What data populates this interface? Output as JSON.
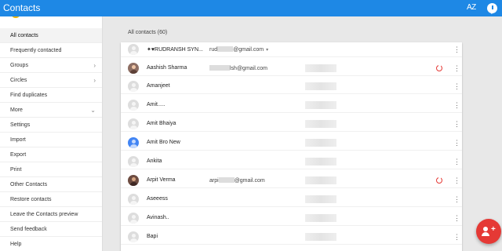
{
  "app": {
    "title": "Contacts",
    "sort_label": "AZ"
  },
  "sidebar": {
    "items": [
      {
        "label": "All contacts"
      },
      {
        "label": "Frequently contacted"
      },
      {
        "label": "Groups"
      },
      {
        "label": "Circles"
      },
      {
        "label": "Find duplicates"
      },
      {
        "label": "More"
      },
      {
        "label": "Settings"
      },
      {
        "label": "Import"
      },
      {
        "label": "Export"
      },
      {
        "label": "Print"
      },
      {
        "label": "Other Contacts"
      },
      {
        "label": "Restore contacts"
      },
      {
        "label": "Leave the Contacts preview"
      },
      {
        "label": "Send feedback"
      },
      {
        "label": "Help"
      }
    ]
  },
  "main": {
    "section_title": "All contacts (60)",
    "contacts": [
      {
        "name": "✦♥RUDRANSH SYN...",
        "email_prefix": "rud",
        "email_suffix": "@gmail.com"
      },
      {
        "name": "Aashish Sharma",
        "email_prefix": "",
        "email_suffix": "lsh@gmail.com"
      },
      {
        "name": "Amanjeet"
      },
      {
        "name": "Amit....."
      },
      {
        "name": "Amit Bhaiya"
      },
      {
        "name": "Amit Bro New"
      },
      {
        "name": "Ankita"
      },
      {
        "name": "Arpit Verma",
        "email_prefix": "arpi",
        "email_suffix": "@gmail.com"
      },
      {
        "name": "Aseeess"
      },
      {
        "name": "Avinash.."
      },
      {
        "name": "Bapi"
      }
    ]
  },
  "icons": {
    "chat": "chat-bubble-icon",
    "kebab": "more-vert-icon",
    "google_plus": "google-plus-icon",
    "fab": "add-contact-icon"
  },
  "colors": {
    "appbar": "#1e88e5",
    "fab": "#e53935",
    "gplus": "#e53935"
  }
}
